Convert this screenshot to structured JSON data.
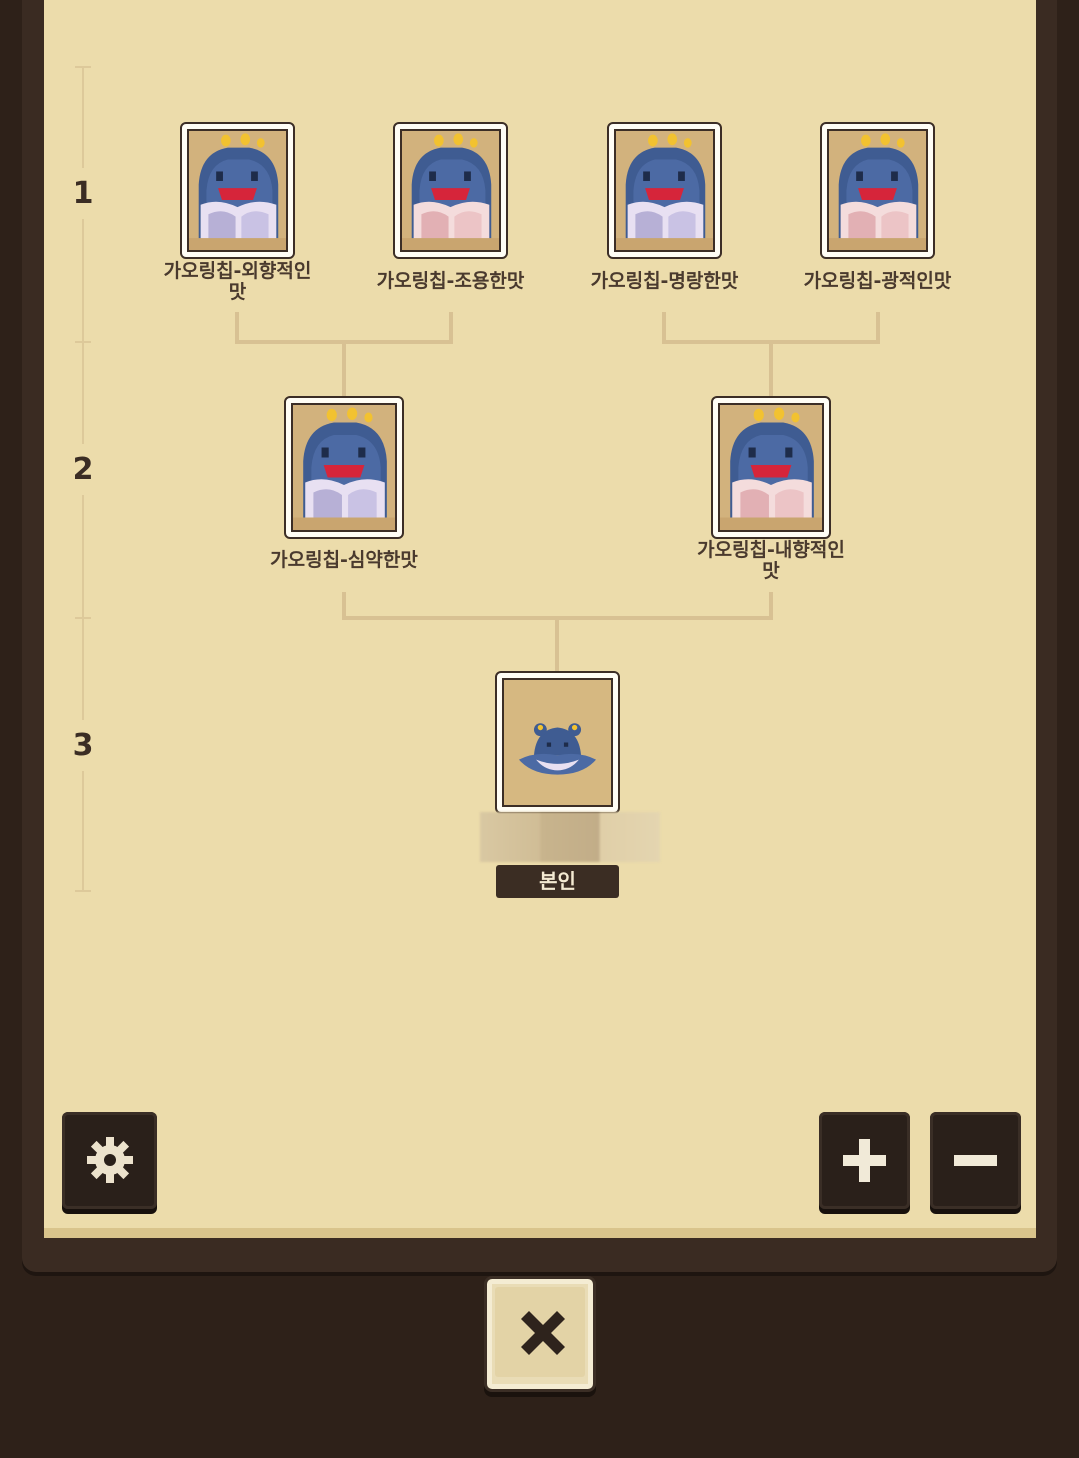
{
  "generations": [
    "1",
    "2",
    "3"
  ],
  "parents_gen1": [
    {
      "name": "가오링칩-외향적인\n맛"
    },
    {
      "name": "가오링칩-조용한맛"
    },
    {
      "name": "가오링칩-명랑한맛"
    },
    {
      "name": "가오링칩-광적인맛"
    }
  ],
  "parents_gen2": [
    {
      "name": "가오링칩-심약한맛"
    },
    {
      "name": "가오링칩-내향적인\n맛"
    }
  ],
  "self": {
    "badge": "본인"
  },
  "controls": {
    "settings_icon": "gear-icon",
    "zoom_in_icon": "plus-icon",
    "zoom_out_icon": "minus-icon",
    "close_icon": "close-icon"
  },
  "colors": {
    "paper": "#ecdcab",
    "frame": "#3a2b22",
    "line": "#d8c193",
    "text": "#4a3a2e"
  }
}
